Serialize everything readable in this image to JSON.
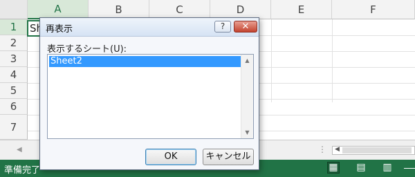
{
  "sheet": {
    "columns": [
      "A",
      "B",
      "C",
      "D",
      "E",
      "F"
    ],
    "rows": [
      "1",
      "2",
      "3",
      "4",
      "5",
      "6",
      "7"
    ],
    "a1_value": "Sh"
  },
  "statusbar": {
    "ready": "準備完了"
  },
  "dialog": {
    "title": "再表示",
    "help": "?",
    "close": "✕",
    "list_label": "表示するシート(U):",
    "sheets": [
      "Sheet2"
    ],
    "ok": "OK",
    "cancel": "キャンセル"
  }
}
